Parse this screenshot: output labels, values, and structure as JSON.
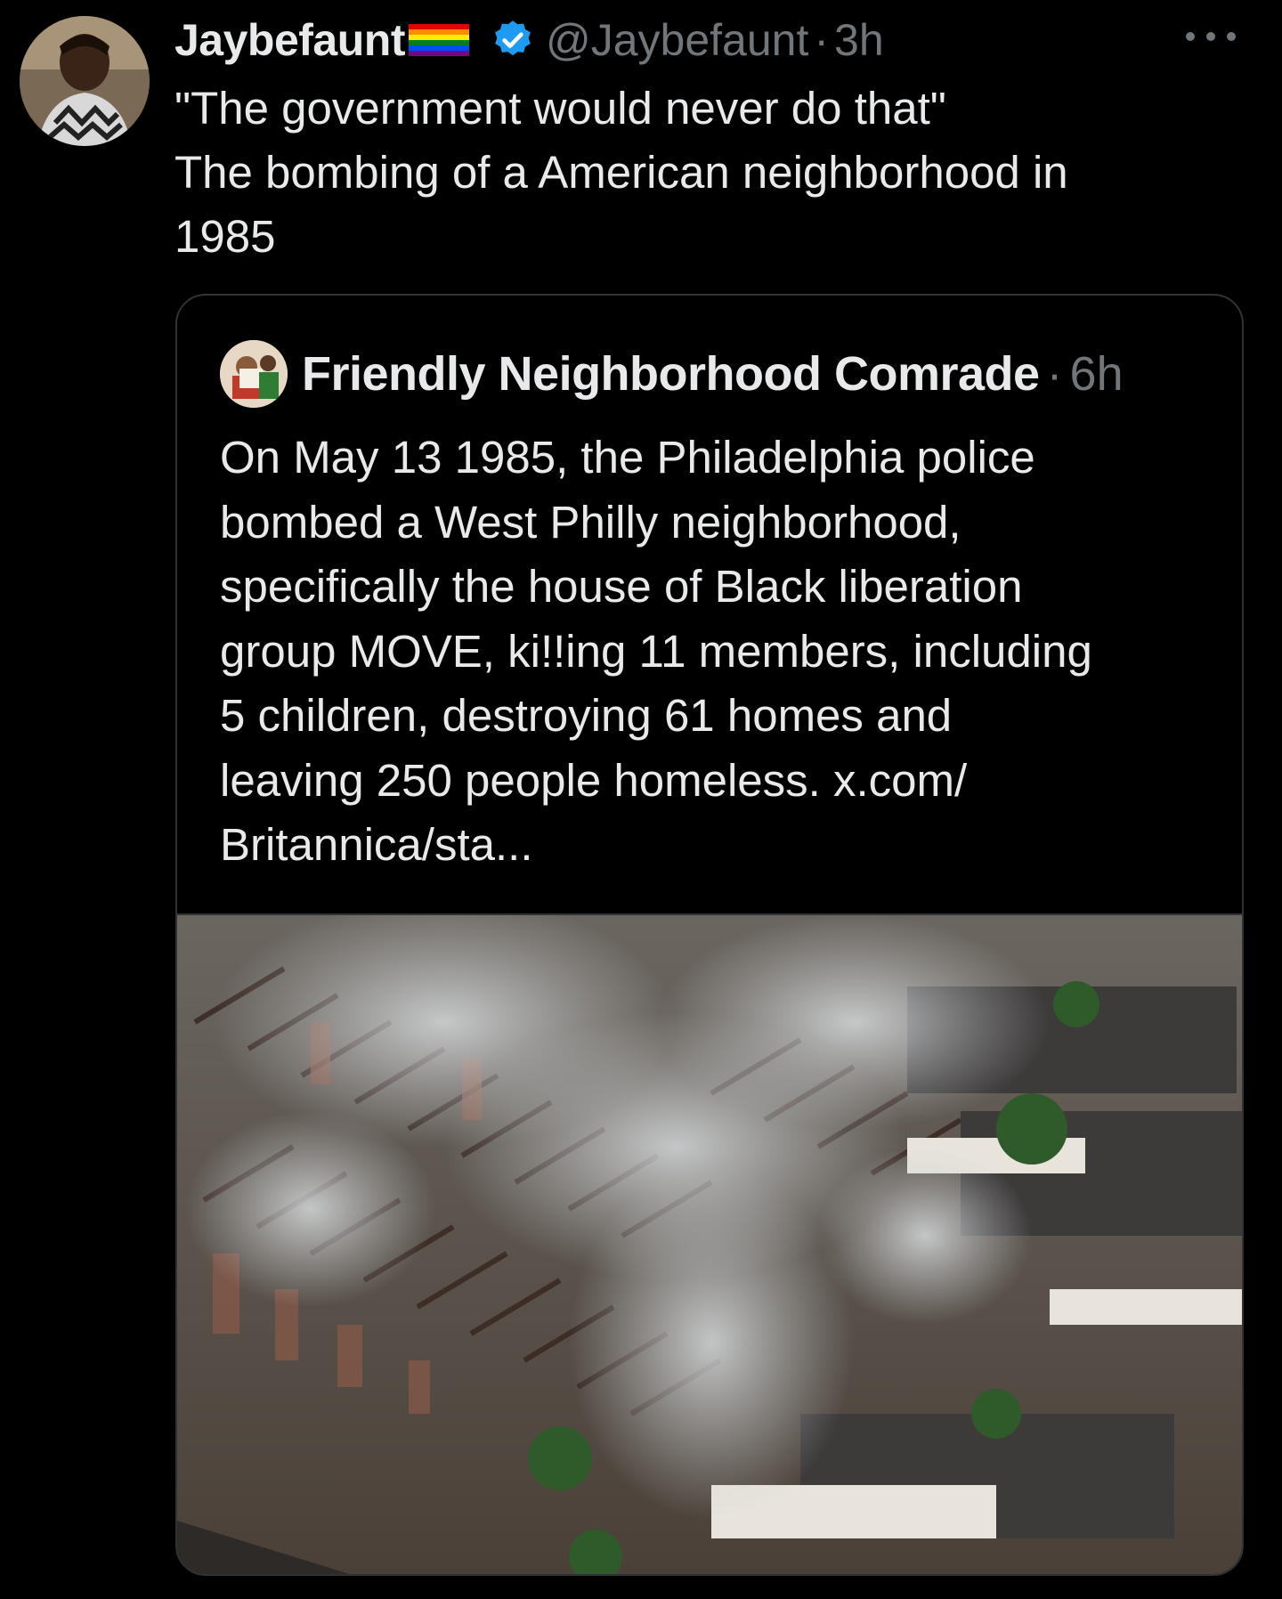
{
  "tweet": {
    "author_name": "Jaybefaunt",
    "author_handle": "@Jaybefaunt",
    "separator": "·",
    "time": "3h",
    "text_lines": [
      "\"The government would never do that\"",
      "The bombing of a American neighborhood in",
      "1985"
    ],
    "icons": {
      "flag": "rainbow-flag-icon",
      "verified": "verified-badge-icon",
      "more": "more-options-icon"
    },
    "colors": {
      "verified": "#1d9bf0",
      "muted": "#71767b",
      "text": "#e7e9ea"
    }
  },
  "quote": {
    "author_name": "Friendly Neighborhood Comrade",
    "separator": "·",
    "time": "6h",
    "text_lines": [
      "On May 13 1985, the Philadelphia police",
      "bombed a West Philly neighborhood,",
      "specifically the house of Black liberation",
      "group MOVE, ki!!ing 11 members, including",
      "5 children, destroying 61 homes and",
      "leaving 250 people homeless. x.com/",
      "Britannica/sta..."
    ],
    "image": "aerial-photo-burned-neighborhood"
  }
}
